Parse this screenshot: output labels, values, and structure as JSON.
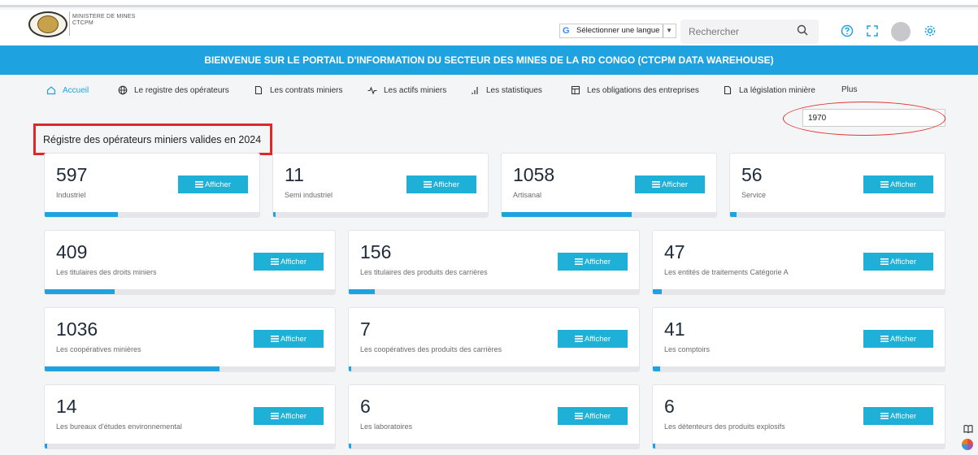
{
  "header": {
    "brand_line1": "MINISTERE DE MINES",
    "brand_line2": "CTCPM",
    "language_selector": "Sélectionner une langue",
    "language_arrow": "▼",
    "search_placeholder": "Rechercher"
  },
  "banner": "BIENVENUE SUR LE PORTAIL D'INFORMATION DU SECTEUR DES MINES DE LA RD CONGO (CTCPM DATA WAREHOUSE)",
  "nav": [
    {
      "label": "Accueil",
      "icon": "home-icon"
    },
    {
      "label": "Le registre des opérateurs",
      "icon": "globe-icon"
    },
    {
      "label": "Les contrats miniers",
      "icon": "document-icon"
    },
    {
      "label": "Les actifs miniers",
      "icon": "pulse-icon"
    },
    {
      "label": "Les statistiques",
      "icon": "bar-chart-icon"
    },
    {
      "label": "Les obligations des entreprises",
      "icon": "table-icon"
    },
    {
      "label": "La législation minière",
      "icon": "document-icon"
    },
    {
      "label": "Plus",
      "icon": ""
    }
  ],
  "filter_value": "1970",
  "section_title": "Régistre des opérateurs miniers valides en 2024",
  "button_label": "Afficher",
  "colors": {
    "accent": "#1fa3e0",
    "button": "#1fb0d8",
    "highlight": "#e02828"
  },
  "cards": [
    {
      "value": "597",
      "label": "Industriel",
      "progress": 0.34
    },
    {
      "value": "11",
      "label": "Semi industriel",
      "progress": 0.006
    },
    {
      "value": "1058",
      "label": "Artisanal",
      "progress": 0.6
    },
    {
      "value": "56",
      "label": "Service",
      "progress": 0.03
    },
    {
      "value": "409",
      "label": "Les titulaires des droits miniers",
      "progress": 0.24
    },
    {
      "value": "156",
      "label": "Les titulaires des produits des carrières",
      "progress": 0.09
    },
    {
      "value": "47",
      "label": "Les entités de traitements Catégorie A",
      "progress": 0.03
    },
    {
      "value": "1036",
      "label": "Les coopératives minières",
      "progress": 0.6
    },
    {
      "value": "7",
      "label": "Les coopératives des produits des carrières",
      "progress": 0.005
    },
    {
      "value": "41",
      "label": "Les comptoirs",
      "progress": 0.025
    },
    {
      "value": "14",
      "label": "Les bureaux d'études environnemental",
      "progress": 0.008
    },
    {
      "value": "6",
      "label": "Les laboratoires",
      "progress": 0.004
    },
    {
      "value": "6",
      "label": "Les détenteurs des produits explosifs",
      "progress": 0.004
    }
  ]
}
